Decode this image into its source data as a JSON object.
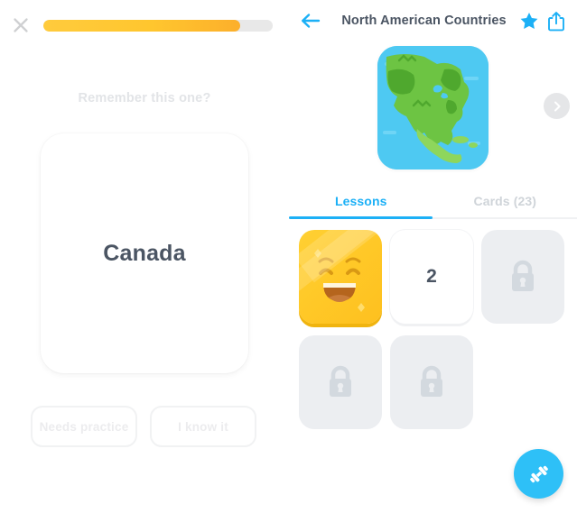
{
  "practice": {
    "close_icon": "close-icon",
    "progress_percent": 86,
    "progress_fill_color": "#FFC62E",
    "progress_track_color": "#E8E8E8",
    "prompt": "Remember this one?",
    "card_term": "Canada",
    "buttons": {
      "needs_practice": "Needs practice",
      "i_know_it": "I know it"
    }
  },
  "deck": {
    "back_icon": "arrow-left-icon",
    "title": "North American Countries",
    "star_icon": "star-icon",
    "share_icon": "share-icon",
    "hero_image_alt": "north-america-map-illustration",
    "carousel_next_icon": "chevron-right-icon",
    "accent_color": "#1CB0F6",
    "tabs": [
      {
        "label": "Lessons",
        "active": true
      },
      {
        "label": "Cards (23)",
        "active": false
      }
    ],
    "lessons": [
      {
        "state": "done",
        "label": "",
        "icon": "smiling-face-icon"
      },
      {
        "state": "current",
        "label": "2",
        "icon": ""
      },
      {
        "state": "locked",
        "label": "",
        "icon": "lock-icon"
      },
      {
        "state": "locked",
        "label": "",
        "icon": "lock-icon"
      },
      {
        "state": "locked",
        "label": "",
        "icon": "lock-icon"
      }
    ],
    "fab_icon": "dumbbell-icon"
  }
}
